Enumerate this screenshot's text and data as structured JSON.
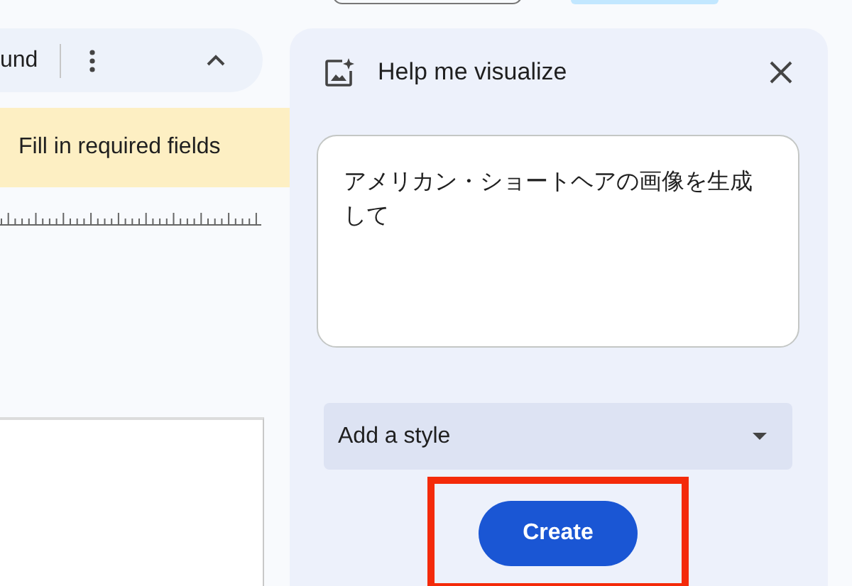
{
  "toolbar": {
    "label": "und"
  },
  "banner": {
    "text": "Fill in required fields"
  },
  "panel": {
    "title": "Help me visualize",
    "prompt": "アメリカン・ショートヘアの画像を生成して",
    "style_select": {
      "placeholder": "Add a style"
    },
    "create_button": {
      "label": "Create",
      "highlighted": true
    }
  }
}
